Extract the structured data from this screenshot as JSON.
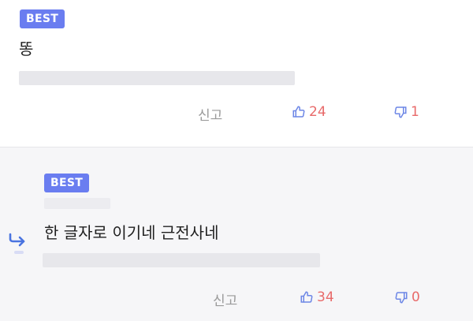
{
  "comments": [
    {
      "badge": "BEST",
      "text": "똥",
      "report": "신고",
      "likes": "24",
      "dislikes": "1"
    },
    {
      "badge": "BEST",
      "text": "한 글자로 이기네 근전사네",
      "report": "신고",
      "likes": "34",
      "dislikes": "0"
    }
  ],
  "icons": {
    "up": "thumbs-up-icon",
    "down": "thumbs-down-icon",
    "reply": "reply-arrow-icon"
  },
  "colors": {
    "badge": "#6a7df0",
    "count": "#e86a6a",
    "icon": "#6c86e6",
    "reply_arrow": "#4a74e0"
  }
}
